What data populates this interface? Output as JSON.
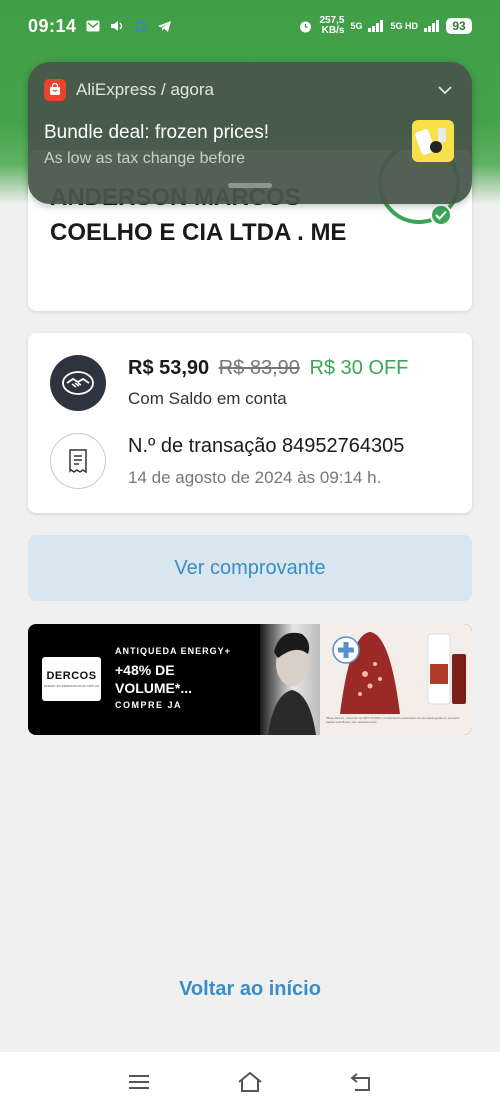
{
  "status_bar": {
    "time": "09:14",
    "speed_value": "257,5",
    "speed_unit": "KB/s",
    "network_1": "5G",
    "network_2": "5G HD",
    "battery": "93"
  },
  "notification": {
    "app": "AliExpress / agora",
    "title": "Bundle deal: frozen prices!",
    "body": "As low as tax change before"
  },
  "receipt": {
    "company_name": "ANDERSON MARCOS COELHO E CIA LTDA . ME",
    "price": "R$ 53,90",
    "original_price": "R$ 83,90",
    "discount": "R$ 30 OFF",
    "payment_method": "Com Saldo em conta",
    "transaction": "N.º de transação 84952764305",
    "date": "14 de agosto de 2024 às 09:14 h.",
    "receipt_button": "Ver comprovante"
  },
  "ad": {
    "brand": "DERCOS",
    "brand_sub": "EXPERT EN DERMATOLOGIA CAPILAR",
    "kicker": "ANTIQUEDA ENERGY+",
    "headline": "+48% DE VOLUME*...",
    "cta": "COMPRE JA",
    "badge": "RECOMENDADO POR DERMATOLOGISTAS",
    "fineprint": "*Base Dercos, referente ao MAT 07/2023, considerando prescrições de dermatologistas no mercado capilar total Brasil, sob medicamentos."
  },
  "footer": {
    "home_link": "Voltar ao início"
  },
  "colors": {
    "header_green": "#45a34b",
    "accent_blue": "#3a8dc5",
    "success_green": "#3aa757"
  }
}
